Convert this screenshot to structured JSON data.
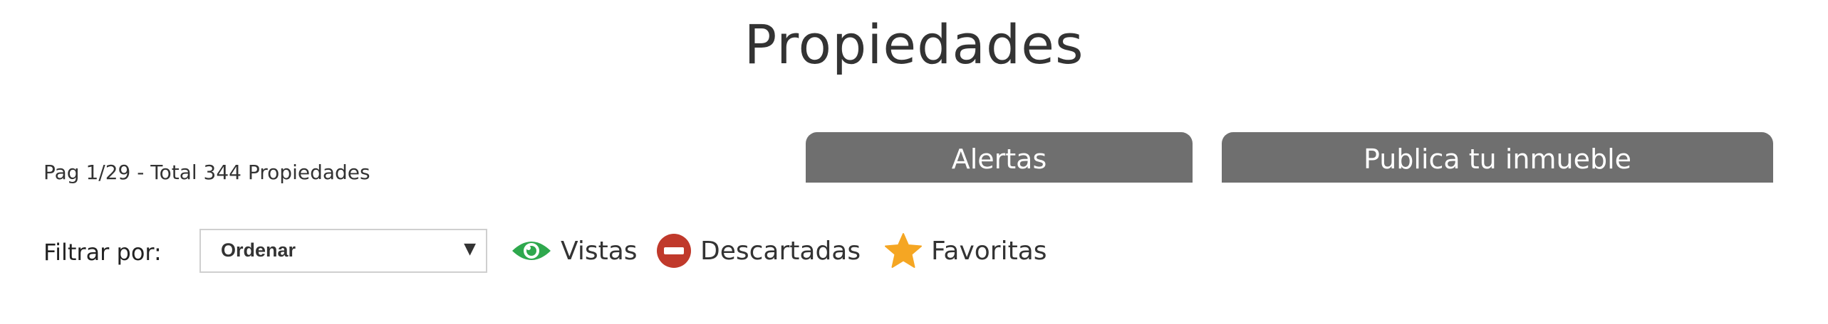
{
  "header": {
    "title": "Propiedades"
  },
  "pagination": {
    "info": "Pag 1/29 - Total 344 Propiedades"
  },
  "actions": {
    "alertas_label": "Alertas",
    "publica_label": "Publica tu inmueble"
  },
  "filters": {
    "label": "Filtrar por:",
    "sort_select": {
      "selected": "Ordenar"
    },
    "chips": [
      {
        "label": "Vistas",
        "icon": "eye-icon",
        "color": "#2ea84d"
      },
      {
        "label": "Descartadas",
        "icon": "minus-circle-icon",
        "color": "#c0392b"
      },
      {
        "label": "Favoritas",
        "icon": "star-icon",
        "color": "#f5a623"
      }
    ]
  },
  "colors": {
    "tab_background": "#6f6f6f",
    "text": "#333333"
  }
}
